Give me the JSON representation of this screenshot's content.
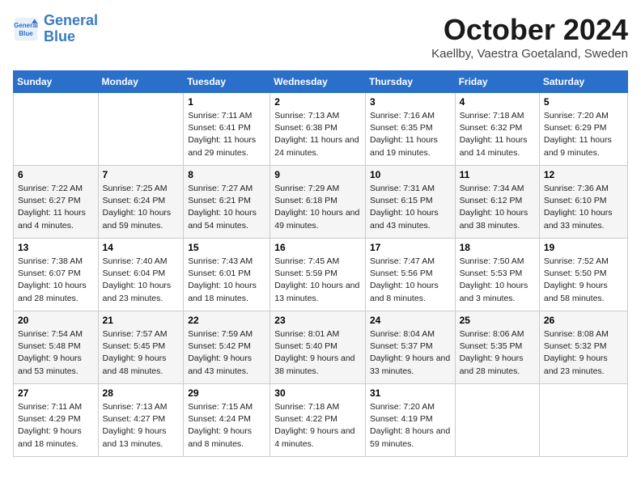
{
  "header": {
    "logo_line1": "General",
    "logo_line2": "Blue",
    "month": "October 2024",
    "location": "Kaellby, Vaestra Goetaland, Sweden"
  },
  "days_of_week": [
    "Sunday",
    "Monday",
    "Tuesday",
    "Wednesday",
    "Thursday",
    "Friday",
    "Saturday"
  ],
  "weeks": [
    [
      {
        "day": "",
        "detail": ""
      },
      {
        "day": "",
        "detail": ""
      },
      {
        "day": "1",
        "detail": "Sunrise: 7:11 AM\nSunset: 6:41 PM\nDaylight: 11 hours and 29 minutes."
      },
      {
        "day": "2",
        "detail": "Sunrise: 7:13 AM\nSunset: 6:38 PM\nDaylight: 11 hours and 24 minutes."
      },
      {
        "day": "3",
        "detail": "Sunrise: 7:16 AM\nSunset: 6:35 PM\nDaylight: 11 hours and 19 minutes."
      },
      {
        "day": "4",
        "detail": "Sunrise: 7:18 AM\nSunset: 6:32 PM\nDaylight: 11 hours and 14 minutes."
      },
      {
        "day": "5",
        "detail": "Sunrise: 7:20 AM\nSunset: 6:29 PM\nDaylight: 11 hours and 9 minutes."
      }
    ],
    [
      {
        "day": "6",
        "detail": "Sunrise: 7:22 AM\nSunset: 6:27 PM\nDaylight: 11 hours and 4 minutes."
      },
      {
        "day": "7",
        "detail": "Sunrise: 7:25 AM\nSunset: 6:24 PM\nDaylight: 10 hours and 59 minutes."
      },
      {
        "day": "8",
        "detail": "Sunrise: 7:27 AM\nSunset: 6:21 PM\nDaylight: 10 hours and 54 minutes."
      },
      {
        "day": "9",
        "detail": "Sunrise: 7:29 AM\nSunset: 6:18 PM\nDaylight: 10 hours and 49 minutes."
      },
      {
        "day": "10",
        "detail": "Sunrise: 7:31 AM\nSunset: 6:15 PM\nDaylight: 10 hours and 43 minutes."
      },
      {
        "day": "11",
        "detail": "Sunrise: 7:34 AM\nSunset: 6:12 PM\nDaylight: 10 hours and 38 minutes."
      },
      {
        "day": "12",
        "detail": "Sunrise: 7:36 AM\nSunset: 6:10 PM\nDaylight: 10 hours and 33 minutes."
      }
    ],
    [
      {
        "day": "13",
        "detail": "Sunrise: 7:38 AM\nSunset: 6:07 PM\nDaylight: 10 hours and 28 minutes."
      },
      {
        "day": "14",
        "detail": "Sunrise: 7:40 AM\nSunset: 6:04 PM\nDaylight: 10 hours and 23 minutes."
      },
      {
        "day": "15",
        "detail": "Sunrise: 7:43 AM\nSunset: 6:01 PM\nDaylight: 10 hours and 18 minutes."
      },
      {
        "day": "16",
        "detail": "Sunrise: 7:45 AM\nSunset: 5:59 PM\nDaylight: 10 hours and 13 minutes."
      },
      {
        "day": "17",
        "detail": "Sunrise: 7:47 AM\nSunset: 5:56 PM\nDaylight: 10 hours and 8 minutes."
      },
      {
        "day": "18",
        "detail": "Sunrise: 7:50 AM\nSunset: 5:53 PM\nDaylight: 10 hours and 3 minutes."
      },
      {
        "day": "19",
        "detail": "Sunrise: 7:52 AM\nSunset: 5:50 PM\nDaylight: 9 hours and 58 minutes."
      }
    ],
    [
      {
        "day": "20",
        "detail": "Sunrise: 7:54 AM\nSunset: 5:48 PM\nDaylight: 9 hours and 53 minutes."
      },
      {
        "day": "21",
        "detail": "Sunrise: 7:57 AM\nSunset: 5:45 PM\nDaylight: 9 hours and 48 minutes."
      },
      {
        "day": "22",
        "detail": "Sunrise: 7:59 AM\nSunset: 5:42 PM\nDaylight: 9 hours and 43 minutes."
      },
      {
        "day": "23",
        "detail": "Sunrise: 8:01 AM\nSunset: 5:40 PM\nDaylight: 9 hours and 38 minutes."
      },
      {
        "day": "24",
        "detail": "Sunrise: 8:04 AM\nSunset: 5:37 PM\nDaylight: 9 hours and 33 minutes."
      },
      {
        "day": "25",
        "detail": "Sunrise: 8:06 AM\nSunset: 5:35 PM\nDaylight: 9 hours and 28 minutes."
      },
      {
        "day": "26",
        "detail": "Sunrise: 8:08 AM\nSunset: 5:32 PM\nDaylight: 9 hours and 23 minutes."
      }
    ],
    [
      {
        "day": "27",
        "detail": "Sunrise: 7:11 AM\nSunset: 4:29 PM\nDaylight: 9 hours and 18 minutes."
      },
      {
        "day": "28",
        "detail": "Sunrise: 7:13 AM\nSunset: 4:27 PM\nDaylight: 9 hours and 13 minutes."
      },
      {
        "day": "29",
        "detail": "Sunrise: 7:15 AM\nSunset: 4:24 PM\nDaylight: 9 hours and 8 minutes."
      },
      {
        "day": "30",
        "detail": "Sunrise: 7:18 AM\nSunset: 4:22 PM\nDaylight: 9 hours and 4 minutes."
      },
      {
        "day": "31",
        "detail": "Sunrise: 7:20 AM\nSunset: 4:19 PM\nDaylight: 8 hours and 59 minutes."
      },
      {
        "day": "",
        "detail": ""
      },
      {
        "day": "",
        "detail": ""
      }
    ]
  ]
}
